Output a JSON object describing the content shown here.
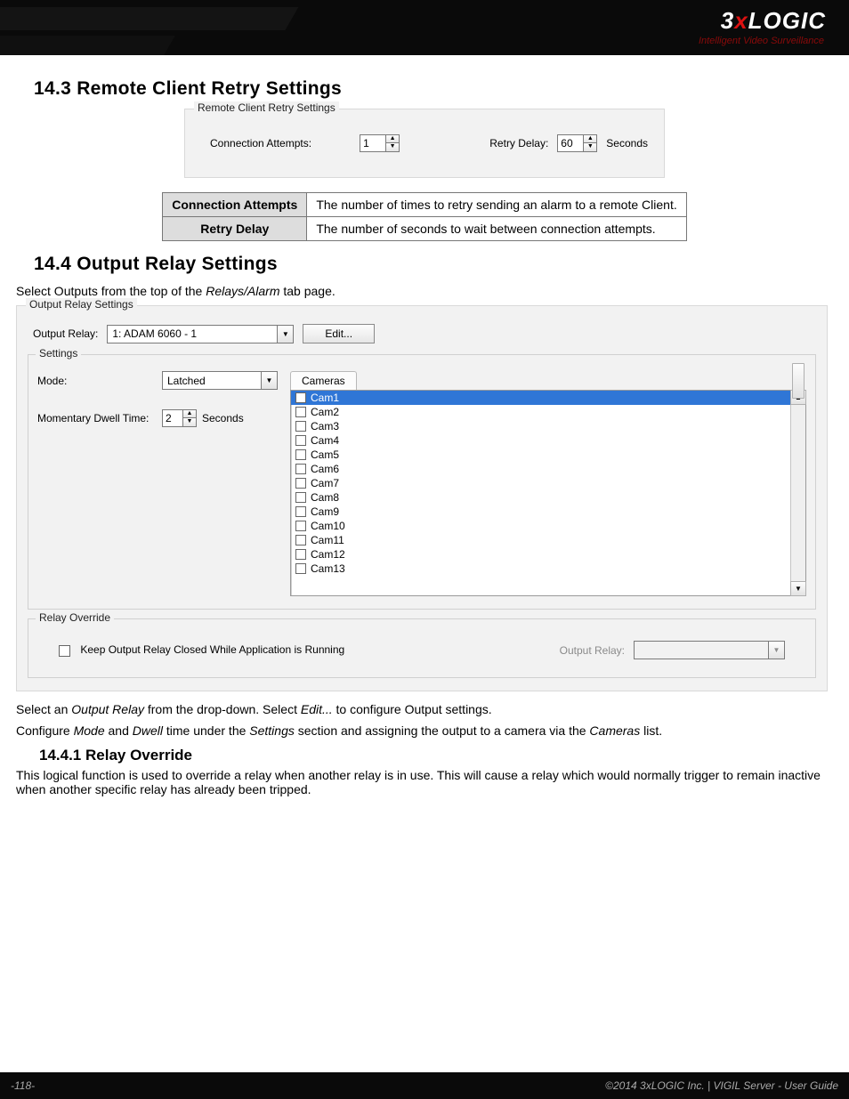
{
  "brand": {
    "logo_pre": "3",
    "logo_x": "x",
    "logo_post": "LOGIC",
    "tagline": "Intelligent Video Surveillance"
  },
  "sections": {
    "s143": {
      "title": "14.3 Remote Client Retry Settings"
    },
    "s144": {
      "title": "14.4 Output Relay Settings",
      "intro_pre": "Select Outputs from the top of the ",
      "intro_em": "Relays/Alarm",
      "intro_post": " tab page."
    },
    "s1441": {
      "title": "14.4.1 Relay Override",
      "para": "This logical function is used to override a relay when another relay is in use. This will cause a relay which would normally trigger to remain inactive when another specific relay has already been tripped."
    }
  },
  "fig1": {
    "legend": "Remote Client Retry Settings",
    "conn_label": "Connection Attempts:",
    "conn_value": "1",
    "retry_label": "Retry Delay:",
    "retry_value": "60",
    "retry_unit": "Seconds"
  },
  "def_table": {
    "rows": [
      {
        "term": "Connection Attempts",
        "desc": "The number of times to retry sending an alarm to a remote Client."
      },
      {
        "term": "Retry Delay",
        "desc": "The number of seconds to wait between connection attempts."
      }
    ]
  },
  "fig2": {
    "legend": "Output Relay Settings",
    "output_relay_label": "Output Relay:",
    "output_relay_value": "1: ADAM 6060 - 1",
    "edit_btn": "Edit...",
    "settings_legend": "Settings",
    "mode_label": "Mode:",
    "mode_value": "Latched",
    "dwell_label": "Momentary Dwell Time:",
    "dwell_value": "2",
    "dwell_unit": "Seconds",
    "cameras_tab": "Cameras",
    "cameras": [
      "Cam1",
      "Cam2",
      "Cam3",
      "Cam4",
      "Cam5",
      "Cam6",
      "Cam7",
      "Cam8",
      "Cam9",
      "Cam10",
      "Cam11",
      "Cam12",
      "Cam13"
    ],
    "override_legend": "Relay Override",
    "override_check_label": "Keep Output Relay Closed While Application is Running",
    "override_relay_label": "Output Relay:"
  },
  "body_after_fig": {
    "p1a": "Select an ",
    "p1b": "Output Relay",
    "p1c": "  from the drop-down. Select ",
    "p1d": "Edit...",
    "p1e": " to configure Output settings.",
    "p2a": "Configure ",
    "p2b": "Mode",
    "p2c": " and ",
    "p2d": "Dwell",
    "p2e": " time under the ",
    "p2f": "Settings",
    "p2g": " section and assigning the output to a camera via the ",
    "p2h": "Cameras",
    "p2i": " list."
  },
  "footer": {
    "page": "-118-",
    "copyright": "©2014 3xLOGIC Inc. | VIGIL Server - User Guide"
  }
}
